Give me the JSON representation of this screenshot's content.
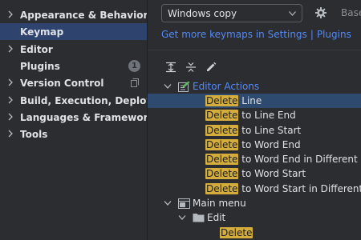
{
  "sidebar": {
    "items": [
      {
        "label": "Appearance & Behavior"
      },
      {
        "label": "Keymap"
      },
      {
        "label": "Editor"
      },
      {
        "label": "Plugins",
        "badge": "1"
      },
      {
        "label": "Version Control"
      },
      {
        "label": "Build, Execution, Deployment"
      },
      {
        "label": "Languages & Frameworks"
      },
      {
        "label": "Tools"
      }
    ]
  },
  "keymap": {
    "selected_keymap": "Windows copy",
    "based_on": "Based",
    "links": [
      "Get more keymaps in Settings",
      "Plugins"
    ],
    "link_separator": "|"
  },
  "toolbar": {
    "icons": [
      "expand-all-icon",
      "collapse-all-icon",
      "edit-icon"
    ]
  },
  "tree": {
    "editor_actions": "Editor Actions",
    "actions": [
      {
        "match": "Delete",
        "rest": " Line"
      },
      {
        "match": "Delete",
        "rest": " to Line End"
      },
      {
        "match": "Delete",
        "rest": " to Line Start"
      },
      {
        "match": "Delete",
        "rest": " to Word End"
      },
      {
        "match": "Delete",
        "rest": " to Word End in Different \"CamelH"
      },
      {
        "match": "Delete",
        "rest": " to Word Start"
      },
      {
        "match": "Delete",
        "rest": " to Word Start in Different \"Camel"
      }
    ],
    "main_menu": "Main menu",
    "edit": "Edit",
    "edit_child": "Delete"
  },
  "colors": {
    "background": "#2b2d30",
    "selection": "#2e436e",
    "link": "#548af7",
    "highlight": "#d4ad3c"
  }
}
